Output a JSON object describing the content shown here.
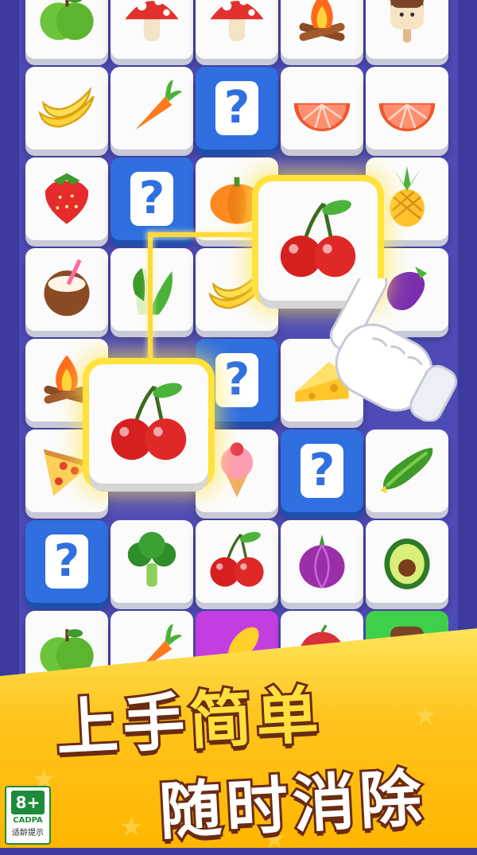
{
  "board": {
    "tiles": [
      {
        "row": 0,
        "col": 0,
        "item": "apple-icon",
        "kind": "normal"
      },
      {
        "row": 0,
        "col": 1,
        "item": "mushroom-icon",
        "kind": "normal"
      },
      {
        "row": 0,
        "col": 2,
        "item": "mushroom-icon",
        "kind": "normal"
      },
      {
        "row": 0,
        "col": 3,
        "item": "campfire-icon",
        "kind": "normal"
      },
      {
        "row": 0,
        "col": 4,
        "item": "popsicle-icon",
        "kind": "normal"
      },
      {
        "row": 1,
        "col": 0,
        "item": "banana-icon",
        "kind": "normal"
      },
      {
        "row": 1,
        "col": 1,
        "item": "carrot-icon",
        "kind": "normal"
      },
      {
        "row": 1,
        "col": 2,
        "item": "question-mark-icon",
        "kind": "mystery"
      },
      {
        "row": 1,
        "col": 3,
        "item": "grapefruit-icon",
        "kind": "normal"
      },
      {
        "row": 1,
        "col": 4,
        "item": "grapefruit-icon",
        "kind": "normal"
      },
      {
        "row": 2,
        "col": 0,
        "item": "strawberry-icon",
        "kind": "normal"
      },
      {
        "row": 2,
        "col": 1,
        "item": "question-mark-icon",
        "kind": "mystery"
      },
      {
        "row": 2,
        "col": 2,
        "item": "pumpkin-icon",
        "kind": "normal"
      },
      {
        "row": 2,
        "col": 4,
        "item": "pineapple-icon",
        "kind": "normal"
      },
      {
        "row": 3,
        "col": 0,
        "item": "coconut-icon",
        "kind": "normal"
      },
      {
        "row": 3,
        "col": 1,
        "item": "bok-choy-icon",
        "kind": "normal"
      },
      {
        "row": 3,
        "col": 2,
        "item": "banana-icon",
        "kind": "normal"
      },
      {
        "row": 3,
        "col": 4,
        "item": "eggplant-icon",
        "kind": "normal"
      },
      {
        "row": 4,
        "col": 0,
        "item": "campfire-icon",
        "kind": "normal"
      },
      {
        "row": 4,
        "col": 2,
        "item": "question-mark-icon",
        "kind": "mystery"
      },
      {
        "row": 4,
        "col": 3,
        "item": "cheese-icon",
        "kind": "normal"
      },
      {
        "row": 5,
        "col": 0,
        "item": "pizza-icon",
        "kind": "normal"
      },
      {
        "row": 5,
        "col": 2,
        "item": "ice-cream-icon",
        "kind": "normal"
      },
      {
        "row": 5,
        "col": 3,
        "item": "question-mark-icon",
        "kind": "mystery"
      },
      {
        "row": 5,
        "col": 4,
        "item": "cucumber-icon",
        "kind": "normal"
      },
      {
        "row": 6,
        "col": 0,
        "item": "question-mark-icon",
        "kind": "mystery"
      },
      {
        "row": 6,
        "col": 1,
        "item": "broccoli-icon",
        "kind": "normal"
      },
      {
        "row": 6,
        "col": 2,
        "item": "cherry-icon",
        "kind": "normal"
      },
      {
        "row": 6,
        "col": 3,
        "item": "onion-icon",
        "kind": "normal"
      },
      {
        "row": 6,
        "col": 4,
        "item": "avocado-icon",
        "kind": "normal"
      },
      {
        "row": 7,
        "col": 0,
        "item": "apple-icon",
        "kind": "normal"
      },
      {
        "row": 7,
        "col": 1,
        "item": "carrot-icon",
        "kind": "normal"
      },
      {
        "row": 7,
        "col": 2,
        "item": "corn-icon",
        "kind": "purple"
      },
      {
        "row": 7,
        "col": 3,
        "item": "lychee-icon",
        "kind": "normal"
      },
      {
        "row": 7,
        "col": 4,
        "item": "popsicle-icon",
        "kind": "green"
      }
    ],
    "matched_pair_item": "cherry-icon",
    "mystery_glyph": "?"
  },
  "banner": {
    "line1_a": "上手",
    "line1_b": "简单",
    "line2": "随时消除"
  },
  "age_rating": {
    "age": "8+",
    "org": "CADPA",
    "tip": "适龄提示"
  },
  "colors": {
    "board": "#4e4bb6",
    "mystery_tile": "#2f6fe0",
    "highlight": "#ffe23c",
    "banner": "#ffc41e"
  }
}
